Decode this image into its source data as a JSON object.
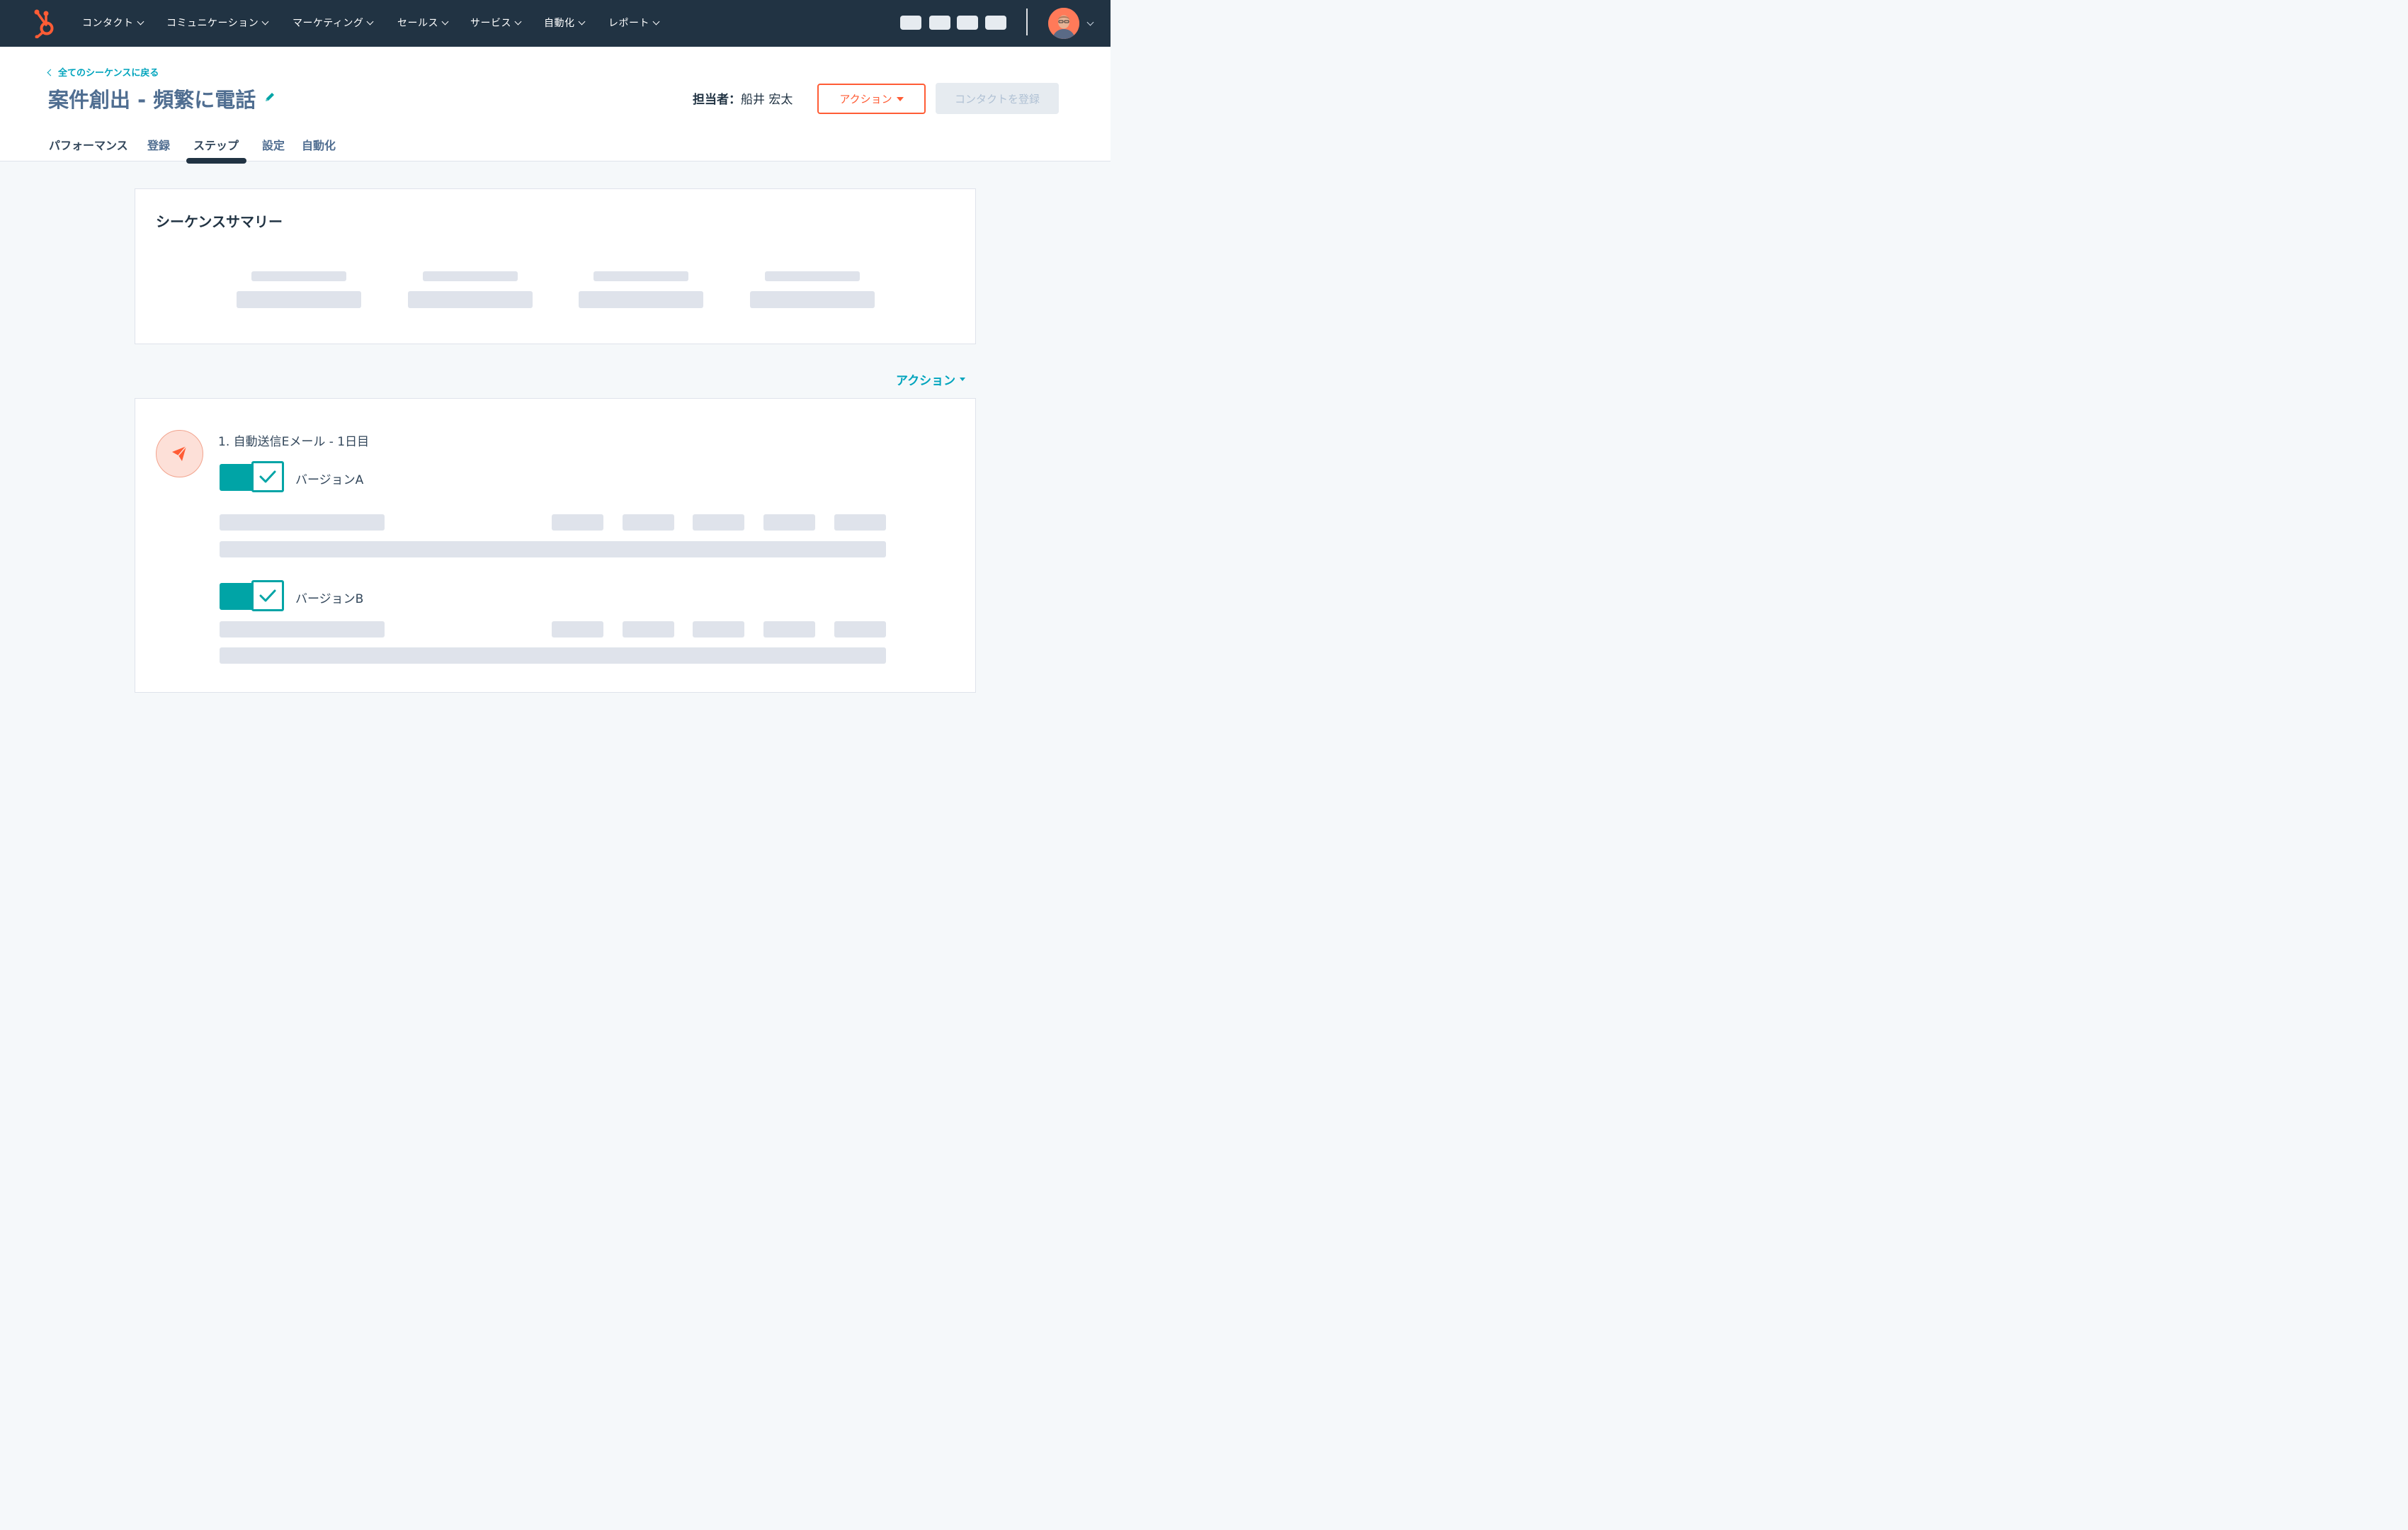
{
  "nav": {
    "items": [
      {
        "label": "コンタクト"
      },
      {
        "label": "コミュニケーション"
      },
      {
        "label": "マーケティング"
      },
      {
        "label": "セールス"
      },
      {
        "label": "サービス"
      },
      {
        "label": "自動化"
      },
      {
        "label": "レポート"
      }
    ],
    "logo_icon": "hubspot-sprocket-icon",
    "brand_color": "#ff5c35"
  },
  "header": {
    "back_link": "全てのシーケンスに戻る",
    "title": "案件創出 - 頻繁に電話",
    "owner_label": "担当者：",
    "owner_name": "船井 宏太",
    "action_button": "アクション",
    "enroll_button": "コンタクトを登録"
  },
  "tabs": [
    {
      "label": "パフォーマンス"
    },
    {
      "label": "登録"
    },
    {
      "label": "ステップ",
      "active": true
    },
    {
      "label": "設定"
    },
    {
      "label": "自動化"
    }
  ],
  "summary": {
    "title": "シーケンスサマリー"
  },
  "actions_link": "アクション",
  "step": {
    "title": "1. 自動送信Eメール - 1日目",
    "icon": "paper-plane-icon",
    "versions": [
      {
        "label": "バージョンA",
        "enabled": true
      },
      {
        "label": "バージョンB",
        "enabled": true
      }
    ]
  },
  "colors": {
    "nav_bg": "#213343",
    "accent_teal": "#00a4bd",
    "toggle_teal": "#00a4a6",
    "orange": "#ff5c35"
  }
}
